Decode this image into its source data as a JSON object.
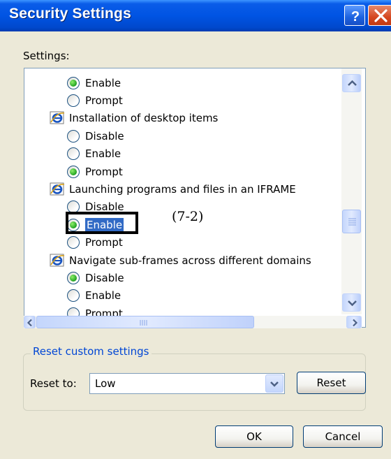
{
  "window": {
    "title": "Security Settings"
  },
  "settings_label": "Settings:",
  "list": {
    "rows": [
      {
        "kind": "option",
        "label": "Enable",
        "checked": true
      },
      {
        "kind": "option",
        "label": "Prompt",
        "checked": false
      },
      {
        "kind": "header",
        "label": "Installation of desktop items"
      },
      {
        "kind": "option",
        "label": "Disable",
        "checked": false
      },
      {
        "kind": "option",
        "label": "Enable",
        "checked": false
      },
      {
        "kind": "option",
        "label": "Prompt",
        "checked": true
      },
      {
        "kind": "header",
        "label": "Launching programs and files in an IFRAME"
      },
      {
        "kind": "option",
        "label": "Disable",
        "checked": false
      },
      {
        "kind": "option",
        "label": "Enable",
        "checked": true,
        "selected": true
      },
      {
        "kind": "option",
        "label": "Prompt",
        "checked": false
      },
      {
        "kind": "header",
        "label": "Navigate sub-frames across different domains"
      },
      {
        "kind": "option",
        "label": "Disable",
        "checked": true
      },
      {
        "kind": "option",
        "label": "Enable",
        "checked": false
      },
      {
        "kind": "option",
        "label": "Prompt",
        "checked": false
      }
    ]
  },
  "annotation": "(7-2)",
  "reset_group": {
    "title": "Reset custom settings",
    "reset_to_label": "Reset to:",
    "reset_to_value": "Low",
    "reset_button": "Reset"
  },
  "buttons": {
    "ok": "OK",
    "cancel": "Cancel"
  },
  "colors": {
    "titlebar": "#0054e3",
    "selection": "#316ac5",
    "radio_check": "#21a121",
    "group_title": "#0046d5"
  },
  "icons": {
    "help": "question-mark-icon",
    "close": "close-x-icon",
    "setting_header": "internet-explorer-icon"
  }
}
